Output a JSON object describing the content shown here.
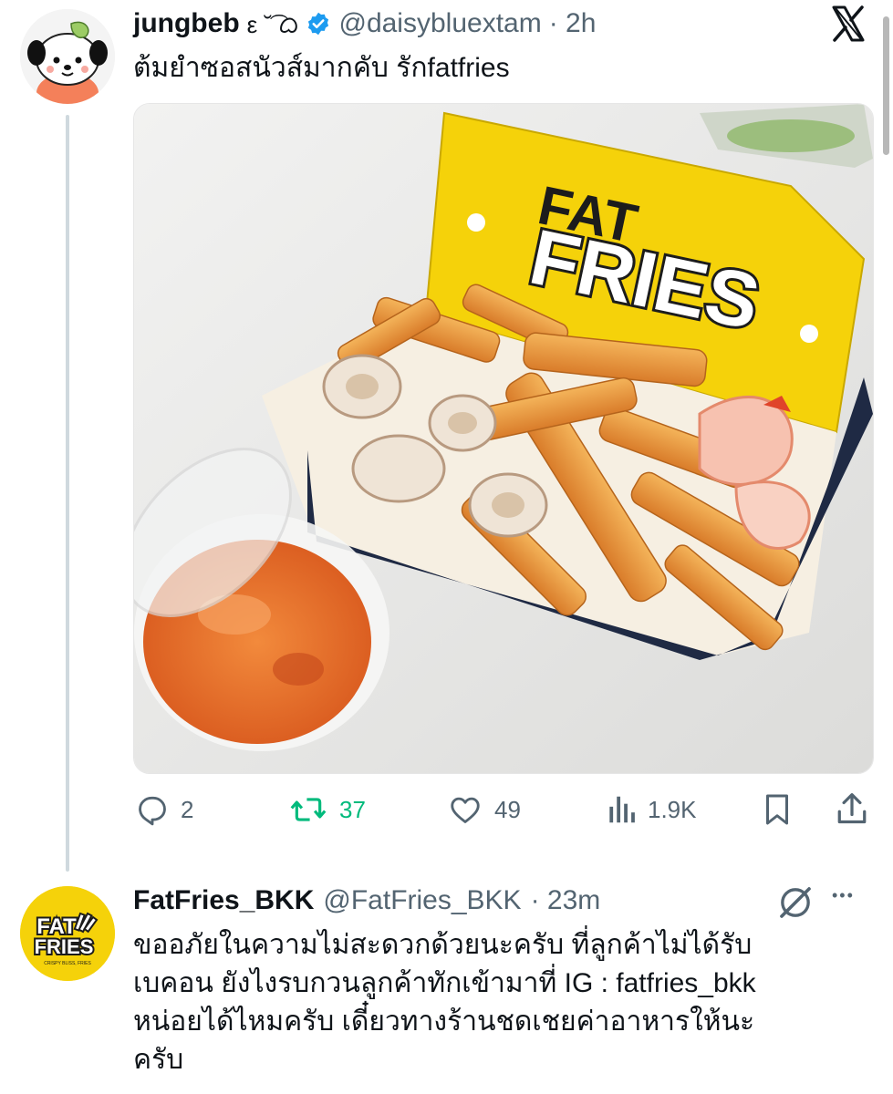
{
  "tweet1": {
    "author_name": "jungbeb",
    "author_name_suffix": "ε ˘͡ ᜊ",
    "handle": "@daisybluextam",
    "time": "· 2h",
    "text": "ต้มยำซอสนัวส์มากคับ รักfatfries",
    "close_glyph": "𝕏",
    "photo": {
      "box_brand_text": "FRIES",
      "box_partial_text": "FAT"
    },
    "actions": {
      "replies": "2",
      "retweets": "37",
      "likes": "49",
      "views": "1.9K"
    }
  },
  "tweet2": {
    "author_name": "FatFries_BKK",
    "handle": "@FatFries_BKK",
    "time": "· 23m",
    "more_glyph": "•••",
    "logo_line1": "FAT",
    "logo_line2": "FRIES",
    "logo_tagline": "CRISPY BLISS, FRIES",
    "text_lines": [
      "ขออภัยในความไม่สะดวกด้วยนะครับ ที่ลูกค้าไม่ได้รับ",
      "เบคอน ยังไงรบกวนลูกค้าทักเข้ามาที่ IG : fatfries_bkk",
      "หน่อยได้ไหมครับ เดี๋ยวทางร้านชดเชยค่าอาหารให้นะ",
      "ครับ"
    ]
  },
  "colors": {
    "retweet_active": "#00ba7c",
    "verified": "#1d9bf0",
    "muted": "#536471",
    "thread_line": "#cfd9de",
    "brand_yellow": "#f5d20a"
  }
}
